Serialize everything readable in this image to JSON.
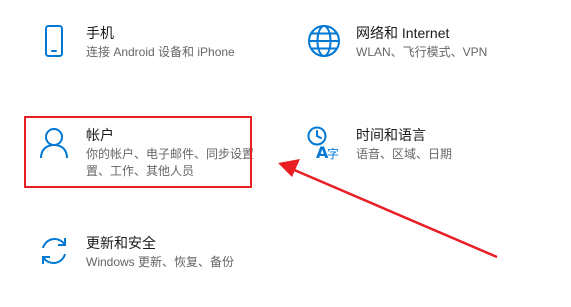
{
  "tiles": {
    "phone": {
      "title": "手机",
      "desc": [
        "连接 Android 设备和 iPhone"
      ],
      "icon": "phone-icon"
    },
    "network": {
      "title": "网络和 Internet",
      "desc": [
        "WLAN、飞行模式、VPN"
      ],
      "icon": "globe-icon"
    },
    "accounts": {
      "title": "帐户",
      "desc": [
        "你的帐户、电子邮件、同步设置",
        "置、工作、其他人员"
      ],
      "icon": "person-icon"
    },
    "time": {
      "title": "时间和语言",
      "desc": [
        "语音、区域、日期"
      ],
      "icon": "time-language-icon"
    },
    "update": {
      "title": "更新和安全",
      "desc": [
        "Windows 更新、恢复、备份"
      ],
      "icon": "sync-arrows-icon"
    }
  },
  "colors": {
    "accent": "#0078d4",
    "annotation": "#e81e25",
    "title_text": "#1a1a1a",
    "desc_text": "#666666"
  }
}
